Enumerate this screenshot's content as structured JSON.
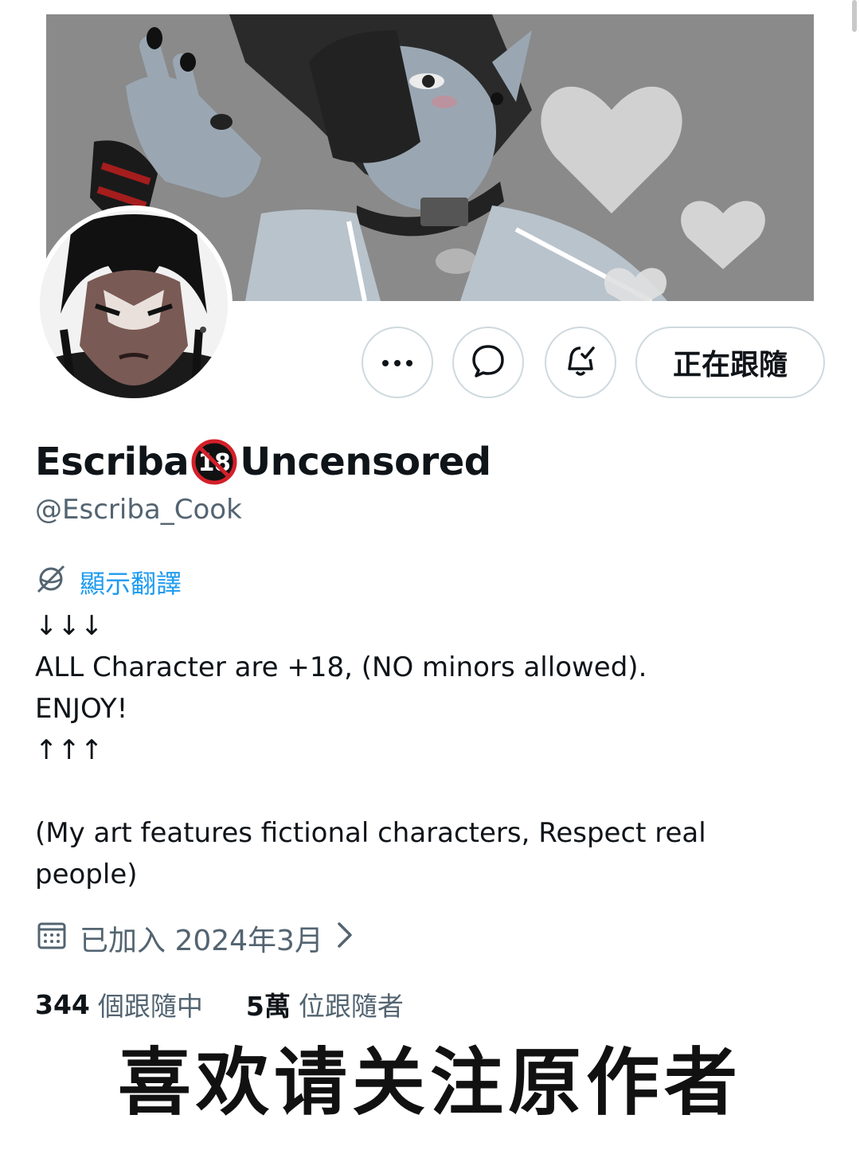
{
  "profile": {
    "display_name_left": "Escriba",
    "display_name_badge": "18",
    "display_name_right": "Uncensored",
    "handle": "@Escriba_Cook"
  },
  "actions": {
    "more_icon": "ellipsis-icon",
    "message_icon": "message-bubble-icon",
    "notify_icon": "bell-check-icon",
    "follow_label": "正在跟隨"
  },
  "translate": {
    "label": "顯示翻譯",
    "icon": "globe-slash-icon"
  },
  "bio": {
    "text": "↓↓↓\nALL Character are +18, (NO minors allowed).\nENJOY!\n↑↑↑\n\n(My art features fictional characters, Respect real\npeople)"
  },
  "joined": {
    "icon": "calendar-icon",
    "label": "已加入 2024年3月",
    "chevron": "›"
  },
  "stats": {
    "following_count": "344",
    "following_label": "個跟隨中",
    "followers_count": "5萬",
    "followers_label": "位跟隨者"
  },
  "overlay": {
    "caption": "喜欢请关注原作者"
  },
  "colors": {
    "accent": "#1d9bf0",
    "secondary_text": "#536471",
    "border": "#cfd9de"
  }
}
